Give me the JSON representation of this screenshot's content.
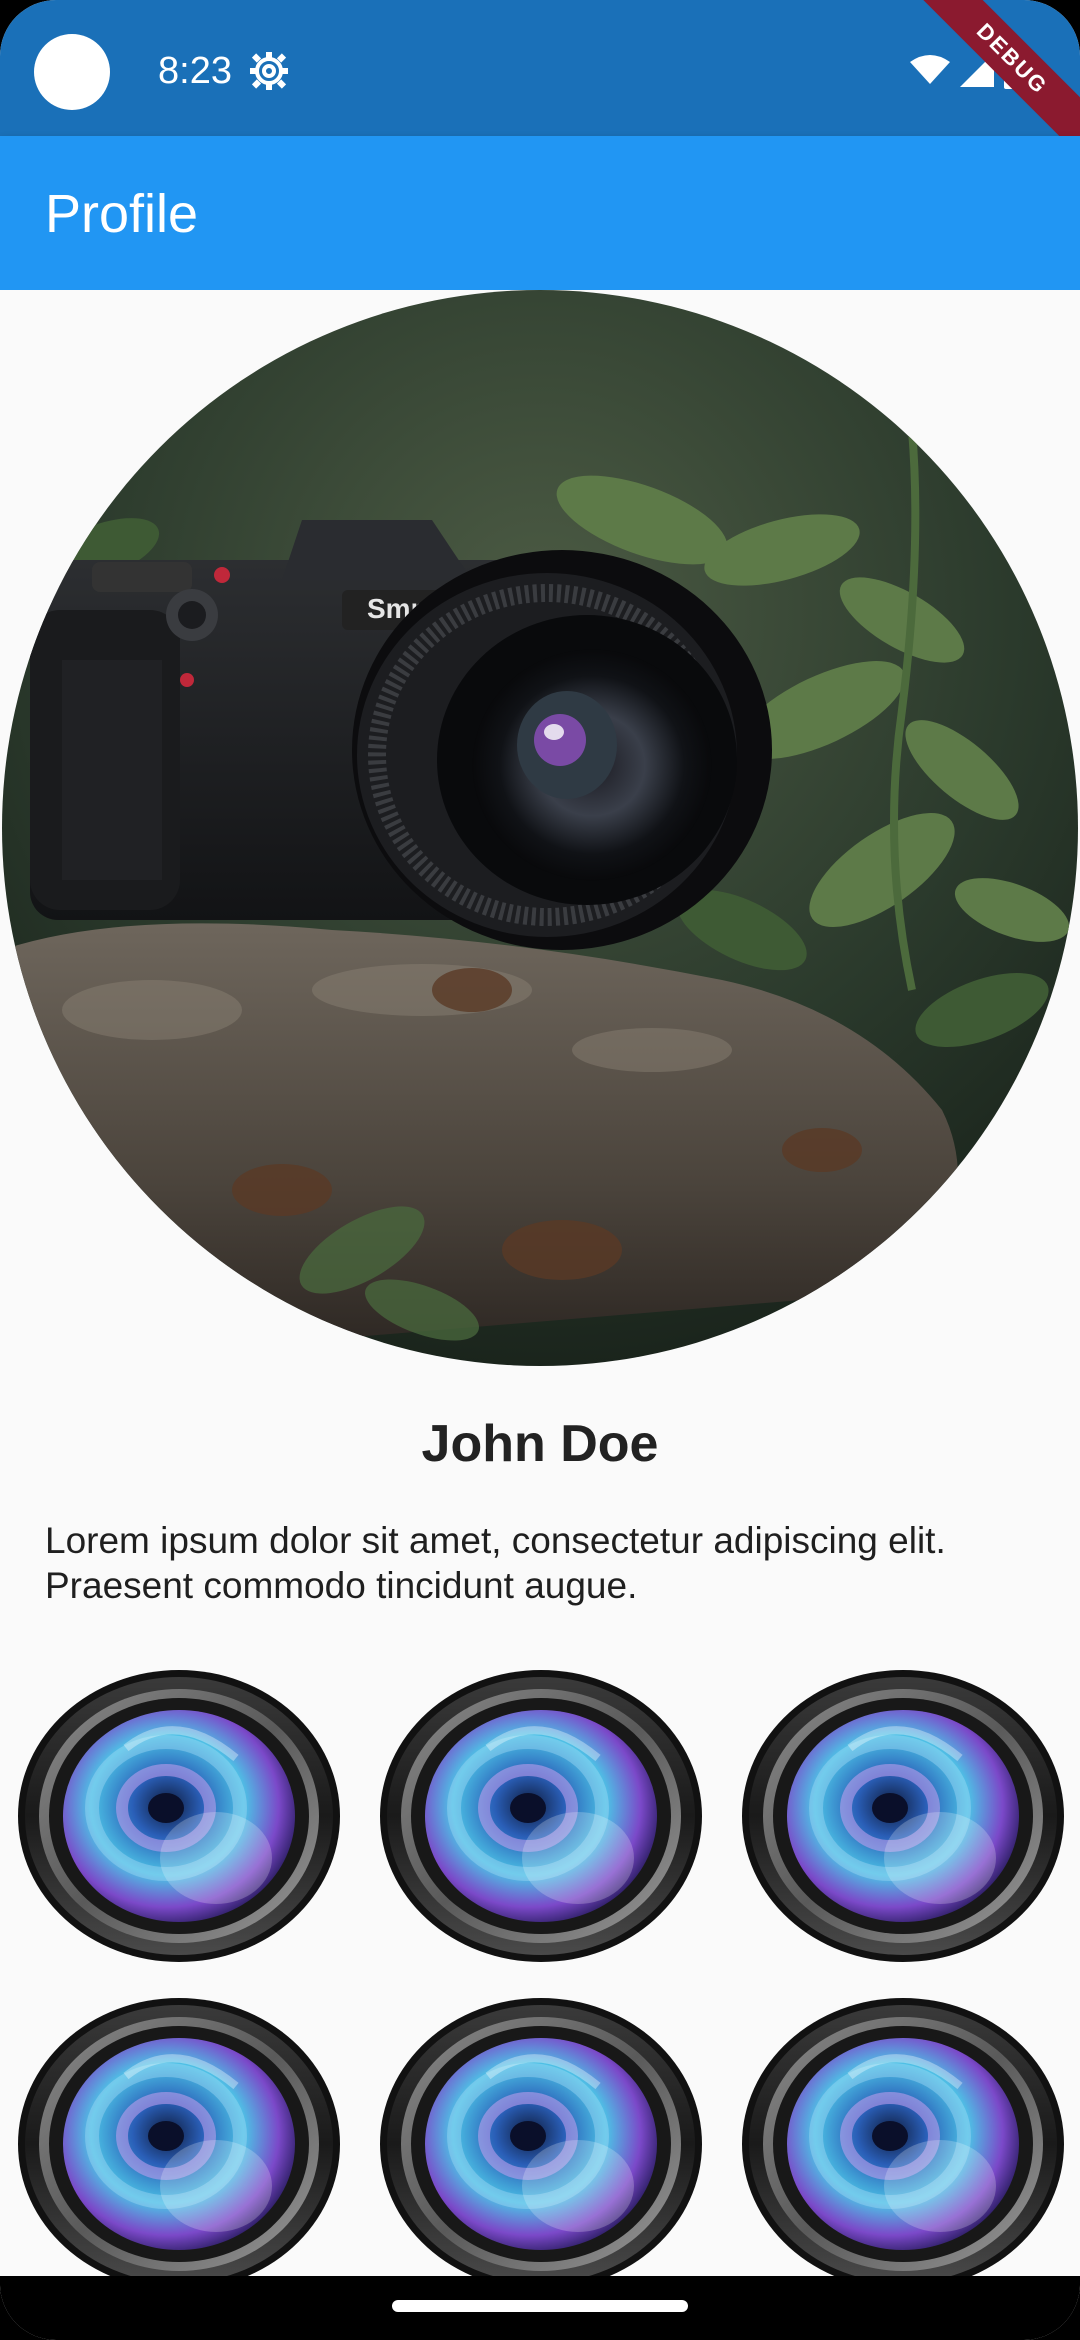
{
  "status_bar": {
    "time": "8:23",
    "icons": [
      "settings-gear-icon",
      "wifi-icon",
      "cellular-signal-icon",
      "battery-icon"
    ],
    "debug_banner": "DEBUG"
  },
  "app_bar": {
    "title": "Profile"
  },
  "profile": {
    "camera_brand": "Smnuvn",
    "name": "John Doe",
    "bio": "Lorem ipsum dolor sit amet, consectetur adipiscing elit. Praesent commodo tincidunt augue."
  },
  "gallery": {
    "items": [
      {
        "icon": "camera-lens-icon"
      },
      {
        "icon": "camera-lens-icon"
      },
      {
        "icon": "camera-lens-icon"
      },
      {
        "icon": "camera-lens-icon"
      },
      {
        "icon": "camera-lens-icon"
      },
      {
        "icon": "camera-lens-icon"
      }
    ]
  },
  "colors": {
    "status_bar": "#1a70b8",
    "app_bar": "#2196f3",
    "background": "#fafafa",
    "text_primary": "#222222",
    "debug_ribbon": "#8b1a2f"
  }
}
